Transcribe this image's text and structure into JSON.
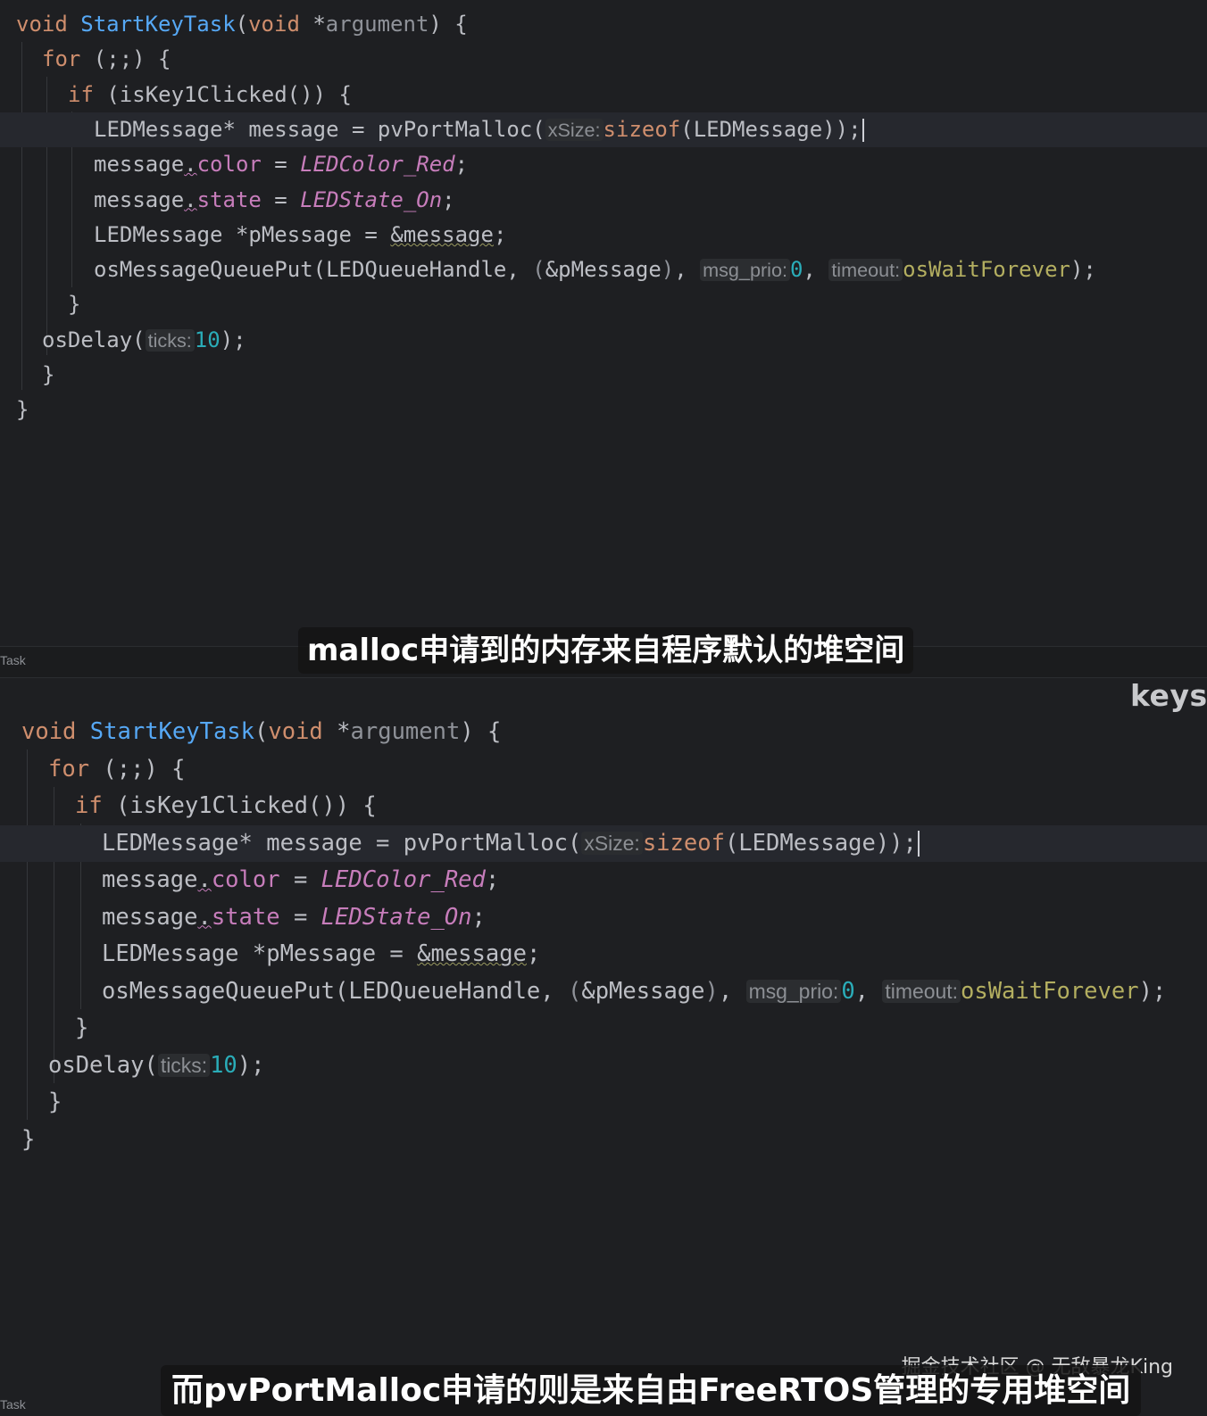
{
  "editor_top": {
    "lines": [
      {
        "html_parts": [
          [
            "kw",
            "void"
          ],
          [
            "plain",
            " "
          ],
          [
            "fn",
            "StartKeyTask"
          ],
          [
            "plain",
            "("
          ],
          [
            "kw",
            "void"
          ],
          [
            "plain",
            " *"
          ],
          [
            "param",
            "argument"
          ],
          [
            "plain",
            ") {"
          ]
        ]
      },
      {
        "html_parts": [
          [
            "kw",
            "for"
          ],
          [
            "plain",
            " (;;) {"
          ]
        ]
      },
      {
        "html_parts": [
          [
            "kw",
            "if"
          ],
          [
            "plain",
            " (isKey1Clicked()) {"
          ]
        ]
      },
      {
        "html_parts": [
          [
            "plain",
            "LEDMessage* message = pvPortMalloc("
          ],
          [
            "hint",
            "xSize:"
          ],
          [
            "kw",
            "sizeof"
          ],
          [
            "plain",
            "(LEDMessage));"
          ]
        ]
      },
      {
        "html_parts": [
          [
            "plain",
            "message"
          ],
          [
            "sq",
            "."
          ],
          [
            "field",
            "color"
          ],
          [
            "plain",
            " = "
          ],
          [
            "const",
            "LEDColor_Red"
          ],
          [
            "plain",
            ";"
          ]
        ]
      },
      {
        "html_parts": [
          [
            "plain",
            "message"
          ],
          [
            "sq",
            "."
          ],
          [
            "field",
            "state"
          ],
          [
            "plain",
            " = "
          ],
          [
            "const",
            "LEDState_On"
          ],
          [
            "plain",
            ";"
          ]
        ]
      },
      {
        "html_parts": [
          [
            "plain",
            "LEDMessage *pMessage = "
          ],
          [
            "sq-amp",
            "&message"
          ],
          [
            "plain",
            ";"
          ]
        ]
      },
      {
        "html_parts": [
          [
            "plain",
            "osMessageQueuePut(LEDQueueHandle, "
          ],
          [
            "param",
            "("
          ],
          [
            "plain",
            "&pMessage"
          ],
          [
            "param",
            ")"
          ],
          [
            "plain",
            ", "
          ],
          [
            "hint",
            "msg_prio:"
          ],
          [
            "num",
            "0"
          ],
          [
            "plain",
            ", "
          ],
          [
            "hint",
            "timeout:"
          ],
          [
            "macro",
            "osWaitForever"
          ],
          [
            "plain",
            ");"
          ]
        ]
      },
      {
        "html_parts": [
          [
            "plain",
            "}"
          ]
        ]
      },
      {
        "html_parts": [
          [
            "plain",
            "osDelay("
          ],
          [
            "hint",
            "ticks:"
          ],
          [
            "num",
            "10"
          ],
          [
            "plain",
            ");"
          ]
        ]
      },
      {
        "html_parts": [
          [
            "plain",
            "}"
          ]
        ]
      },
      {
        "html_parts": [
          [
            "plain",
            "}"
          ]
        ]
      }
    ]
  },
  "status_top": {
    "label": "Task"
  },
  "status_bottom": {
    "label": "Task"
  },
  "side_label": "keysk",
  "captions": {
    "top": "malloc申请到的内存来自程序默认的堆空间",
    "bottom": "而pvPortMalloc申请的则是来自由FreeRTOS管理的专用堆空间"
  },
  "watermark": "掘金技术社区 @ 无敌暴龙King"
}
